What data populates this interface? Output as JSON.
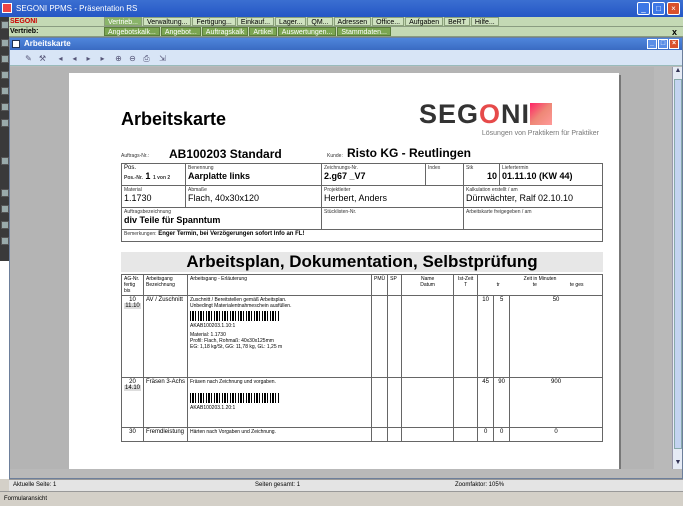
{
  "window": {
    "title": "SEGONI PPMS - Präsentation RS"
  },
  "menu": {
    "label": "SEGONI",
    "items": [
      "Vertrieb...",
      "Verwaltung...",
      "Fertigung...",
      "Einkauf...",
      "Lager...",
      "QM...",
      "Adressen",
      "Office...",
      "Aufgaben",
      "BeRT",
      "Hilfe..."
    ]
  },
  "submenu": {
    "label": "Vertrieb:",
    "items": [
      "Angebotskalk...",
      "Angebot...",
      "Auftragskalk",
      "Artikel",
      "Auswertungen...",
      "Stammdaten..."
    ],
    "close": "x"
  },
  "inner_window": {
    "title": "Arbeitskarte"
  },
  "doc": {
    "title": "Arbeitskarte",
    "logo": {
      "word_a": "SEG",
      "word_b": "O",
      "word_c": "NI",
      "tagline": "Lösungen von Praktikern für Praktiker"
    },
    "auftrag_label": "Auftrags-Nr.:",
    "auftrag_value": "AB100203 Standard",
    "kunde_label": "Kunde:",
    "kunde_value": "Risto KG - Reutlingen",
    "pos_label": "Pos.",
    "pos_von": "1 von 2",
    "pos_nr_label": "Pos.-Nr.",
    "pos_nr": "1",
    "benennung_label": "Benennung",
    "benennung": "Aarplatte links",
    "zeichnung_label": "Zeichnungs-Nr.",
    "zeichnung": "2.g67 _V7",
    "index_label": "Index",
    "stk_label": "Stk",
    "stk": "10",
    "liefertermin_label": "Liefertermin",
    "liefertermin": "01.11.10 (KW 44)",
    "material_label": "Material",
    "material": "1.1730",
    "abmasse_label": "Abmaße",
    "abmasse": "Flach, 40x30x120",
    "projektleiter_label": "Projektleiter",
    "projektleiter": "Herbert, Anders",
    "kalkulation_label": "Kalkulation erstellt / am",
    "kalkulation": "Dürrwächter, Ralf 02.10.10",
    "auftragsbez_label": "Auftragsbezeichnung",
    "auftragsbez": "div Teile für Spanntum",
    "stueckliste_label": "Stücklisten-Nr.",
    "freigabe_label": "Arbeitskarte freigegeben / am",
    "bemerkung_label": "Bemerkungen:",
    "bemerkung": "Enger Termin, bei Verzögerungen sofort Info an FL!",
    "section_title": "Arbeitsplan, Dokumentation, Selbstprüfung",
    "cols": {
      "ag_nr": "AG-Nr.",
      "fertig_bis": "fertig bis",
      "arbeitsgang": "Arbeitsgang",
      "bezeichnung": "Bezeichnung",
      "erlaeuterung": "Arbeitsgang - Erläuterung",
      "pmue": "PMÜ",
      "sp": "SP",
      "name": "Name",
      "datum": "Datum",
      "istzeit": "Ist-Zeit",
      "t": "T",
      "zeit_in_minuten": "Zeit in Minuten",
      "tr": "tr",
      "te": "te",
      "tges": "te ges"
    },
    "rows": [
      {
        "nr": "10",
        "bis": "11.10",
        "ag": "AV / Zuschnitt",
        "lines": [
          "Zuschnitt / Bereitstellen gemäß Arbeitsplan.",
          "Unbedingt Materialentnahmeschein ausfüllen."
        ],
        "code": "AKAB100203.1.10:1",
        "extra": [
          "Material: 1.1730",
          "Profil: Flach, Rohmaß: 40x30x125mm",
          "EG: 1,18 kg/St, GG: 11,78 kg, GL: 1,25 m"
        ],
        "tr": "10",
        "te": "5",
        "tges": "50"
      },
      {
        "nr": "20",
        "bis": "14.10",
        "ag": "Fräsen 3-Achs",
        "lines": [
          "Fräsen nach Zeichnung und vorgaben."
        ],
        "code": "AKAB100203.1.20:1",
        "extra": [],
        "tr": "45",
        "te": "90",
        "tges": "900"
      },
      {
        "nr": "30",
        "bis": "",
        "ag": "Fremdleistung",
        "lines": [
          "Härten nach Vorgaben und Zeichnung."
        ],
        "code": "",
        "extra": [],
        "tr": "0",
        "te": "0",
        "tges": "0"
      }
    ]
  },
  "status": {
    "current_page": "Aktuelle Seite: 1",
    "total_pages": "Seiten gesamt: 1",
    "zoom": "Zoomfaktor: 105%"
  },
  "bottom": {
    "label": "Formularansicht"
  }
}
